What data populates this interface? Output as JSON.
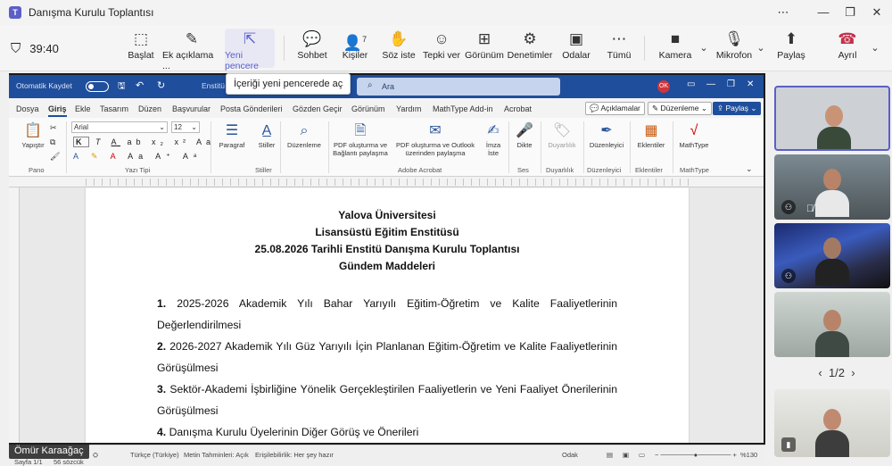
{
  "window": {
    "title": "Danışma Kurulu Toplantısı"
  },
  "meeting": {
    "timer": "39:40",
    "buttons": [
      {
        "label": "Başlat",
        "icon": "whiteboard-icon"
      },
      {
        "label": "Ek açıklama ...",
        "icon": "pen-icon"
      },
      {
        "label": "Yeni pencere",
        "icon": "popout-icon"
      },
      {
        "label": "Sohbet",
        "icon": "chat-icon"
      },
      {
        "label": "Kişiler",
        "icon": "people-icon",
        "badge": "7"
      },
      {
        "label": "Söz iste",
        "icon": "raise-hand-icon"
      },
      {
        "label": "Tepki ver",
        "icon": "smile-icon"
      },
      {
        "label": "Görünüm",
        "icon": "grid-icon"
      },
      {
        "label": "Denetimler",
        "icon": "shield-gear-icon"
      },
      {
        "label": "Odalar",
        "icon": "rooms-icon"
      },
      {
        "label": "Tümü",
        "icon": "more-icon"
      },
      {
        "label": "Kamera",
        "icon": "camera-icon"
      },
      {
        "label": "Mikrofon",
        "icon": "mic-icon"
      },
      {
        "label": "Paylaş",
        "icon": "share-icon"
      },
      {
        "label": "Ayrıl",
        "icon": "hangup-icon"
      }
    ],
    "tooltip": "İçeriği yeni pencerede aç"
  },
  "word": {
    "autosave": "Otomatik Kaydet",
    "docname": "Enstitü D...",
    "search_placeholder": "Ara",
    "user_initials": "OK",
    "tabs": [
      "Dosya",
      "Giriş",
      "Ekle",
      "Tasarım",
      "Düzen",
      "Başvurular",
      "Posta Gönderileri",
      "Gözden Geçir",
      "Görünüm",
      "Yardım",
      "MathType Add-in",
      "Acrobat"
    ],
    "comments_btn": "Açıklamalar",
    "editing_btn": "Düzenleme",
    "share_btn": "Paylaş",
    "font_name": "Arial",
    "font_size": "12",
    "ribbon": {
      "paste": "Yapıştır",
      "paragraph": "Paragraf",
      "styles": "Stiller",
      "editing": "Düzenleme",
      "pdf_share": "PDF oluşturma ve Bağlantı paylaşma",
      "pdf_outlook": "PDF oluşturma ve Outlook üzerinden paylaşma",
      "sign": "İmza İste",
      "dictate": "Dikte",
      "sensitivity": "Duyarlılık",
      "editor": "Düzenleyici",
      "addins": "Eklentiler",
      "mathtype": "MathType",
      "groups": [
        "Pano",
        "Yazı Tipi",
        "Stiller",
        "Adobe Acrobat",
        "Ses",
        "Duyarlılık",
        "Düzenleyici",
        "Eklentiler",
        "MathType"
      ]
    },
    "doc": {
      "line1": "Yalova Üniversitesi",
      "line2": "Lisansüstü Eğitim Enstitüsü",
      "line3": "25.08.2026 Tarihli Enstitü Danışma Kurulu Toplantısı",
      "line4": "Gündem Maddeleri",
      "items": [
        {
          "num": "1.",
          "text": "2025-2026 Akademik Yılı Bahar Yarıyılı Eğitim-Öğretim ve Kalite Faaliyetlerinin Değerlendirilmesi"
        },
        {
          "num": "2.",
          "text": "2026-2027 Akademik Yılı Güz Yarıyılı İçin Planlanan Eğitim-Öğretim ve Kalite Faaliyetlerinin Görüşülmesi"
        },
        {
          "num": "3.",
          "text": "Sektör-Akademi İşbirliğine Yönelik Gerçekleştirilen Faaliyetlerin ve Yeni Faaliyet Önerilerinin Görüşülmesi"
        },
        {
          "num": "4.",
          "text": "Danışma Kurulu Üyelerinin Diğer Görüş ve Önerileri"
        }
      ]
    },
    "status": {
      "page": "Sayfa 1/1",
      "words": "56 sözcük",
      "language": "Türkçe (Türkiye)",
      "predictions": "Metin Tahminleri: Açık",
      "accessibility": "Erişilebilirlik: Her şey hazır",
      "focus": "Odak",
      "zoom": "%130"
    }
  },
  "presenter_name": "Ömür Karaağaç",
  "participants": {
    "pager": "1/2"
  }
}
